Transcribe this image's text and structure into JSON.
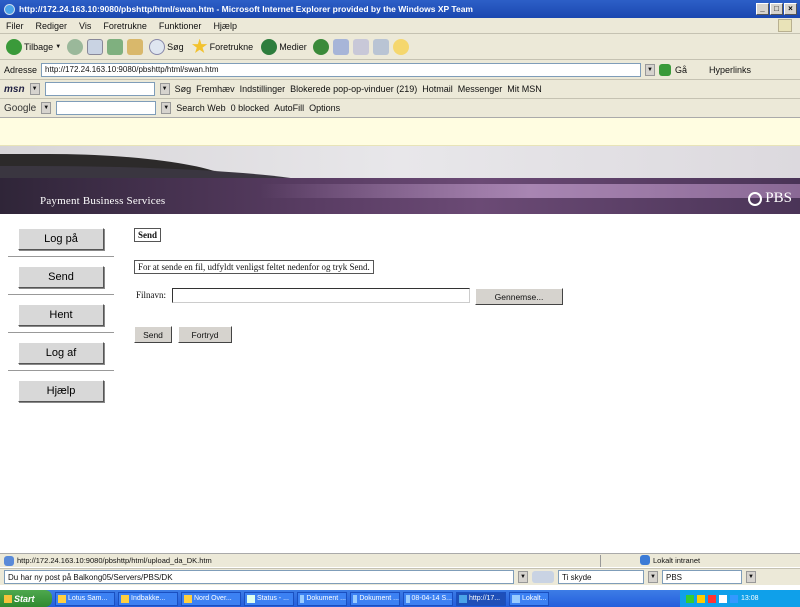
{
  "window": {
    "title": "http://172.24.163.10:9080/pbshttp/html/swan.htm - Microsoft Internet Explorer provided by the Windows XP Team",
    "controls": [
      "_",
      "□",
      "×"
    ]
  },
  "menu": [
    "Filer",
    "Rediger",
    "Vis",
    "Foretrukne",
    "Funktioner",
    "Hjælp"
  ],
  "toolbar": {
    "back": "Tilbage",
    "search": "Søg",
    "favorites": "Foretrukne",
    "media": "Medier"
  },
  "address": {
    "label": "Adresse",
    "value": "http://172.24.163.10:9080/pbshttp/html/swan.htm",
    "go": "Gå",
    "links": "Hyperlinks"
  },
  "msn_bar": {
    "logo": "msn",
    "search": "Søg",
    "highlight": "Fremhæv",
    "options": "Indstillinger",
    "popups": "Blokerede pop-op-vinduer (219)",
    "hotmail": "Hotmail",
    "messenger": "Messenger",
    "my_msn": "Mit MSN"
  },
  "google_bar": {
    "logo": "Google",
    "search_web": "Search Web",
    "blocked": "0 blocked",
    "autofill": "AutoFill",
    "options": "Options"
  },
  "banner": {
    "company": "Payment Business Services",
    "logo_text": "PBS"
  },
  "nav": [
    {
      "label": "Log på"
    },
    {
      "label": "Send"
    },
    {
      "label": "Hent"
    },
    {
      "label": "Log af"
    },
    {
      "label": "Hjælp"
    }
  ],
  "main": {
    "heading": "Send",
    "instruction": "For at sende en fil, udfyldt venligst feltet nedenfor og tryk Send.",
    "file_label": "Filnavn:",
    "file_value": "",
    "browse_button": "Gennemse...",
    "send_button": "Send",
    "cancel_button": "Fortryd"
  },
  "status": {
    "url": "http://172.24.163.10:9080/pbshttp/html/upload_da_DK.htm",
    "zone": "Lokalt intranet"
  },
  "findbar": {
    "text": "Du har ny post på Balkong05/Servers/PBS/DK",
    "field1": "Ti skyde",
    "field2": "PBS"
  },
  "taskbar": {
    "start": "Start",
    "items": [
      "Lotus Sam...",
      "Indbakke...",
      "Nord Over...",
      "Status - ...",
      "Dokument ...",
      "Dokument ...",
      "08-04-14 S...",
      "http://17...",
      "Lokalt..."
    ],
    "clock": "13:08"
  },
  "colors": {
    "title_blue": "#1a47b0",
    "chrome": "#ece9d8",
    "banner_purple": "#4a3457",
    "info_yellow": "#fffde1"
  }
}
